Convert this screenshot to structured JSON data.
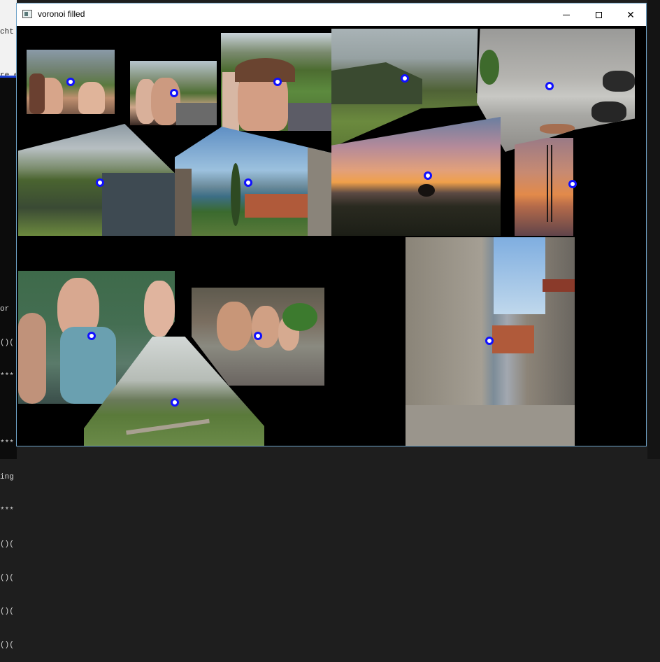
{
  "window": {
    "title": "voronoi filled",
    "minimize_label": "",
    "maximize_label": "",
    "close_label": "✕"
  },
  "background": {
    "left_text_top": [
      "cht",
      "re.ex"
    ],
    "left_text_bottom": [
      "or",
      "()(",
      "***",
      "",
      "***",
      "ing",
      "***",
      "()(",
      "()(",
      "()(",
      "()("
    ]
  },
  "colors": {
    "site": "#1010ff",
    "window_border": "#6fa3c8",
    "canvas": "#000000"
  }
}
